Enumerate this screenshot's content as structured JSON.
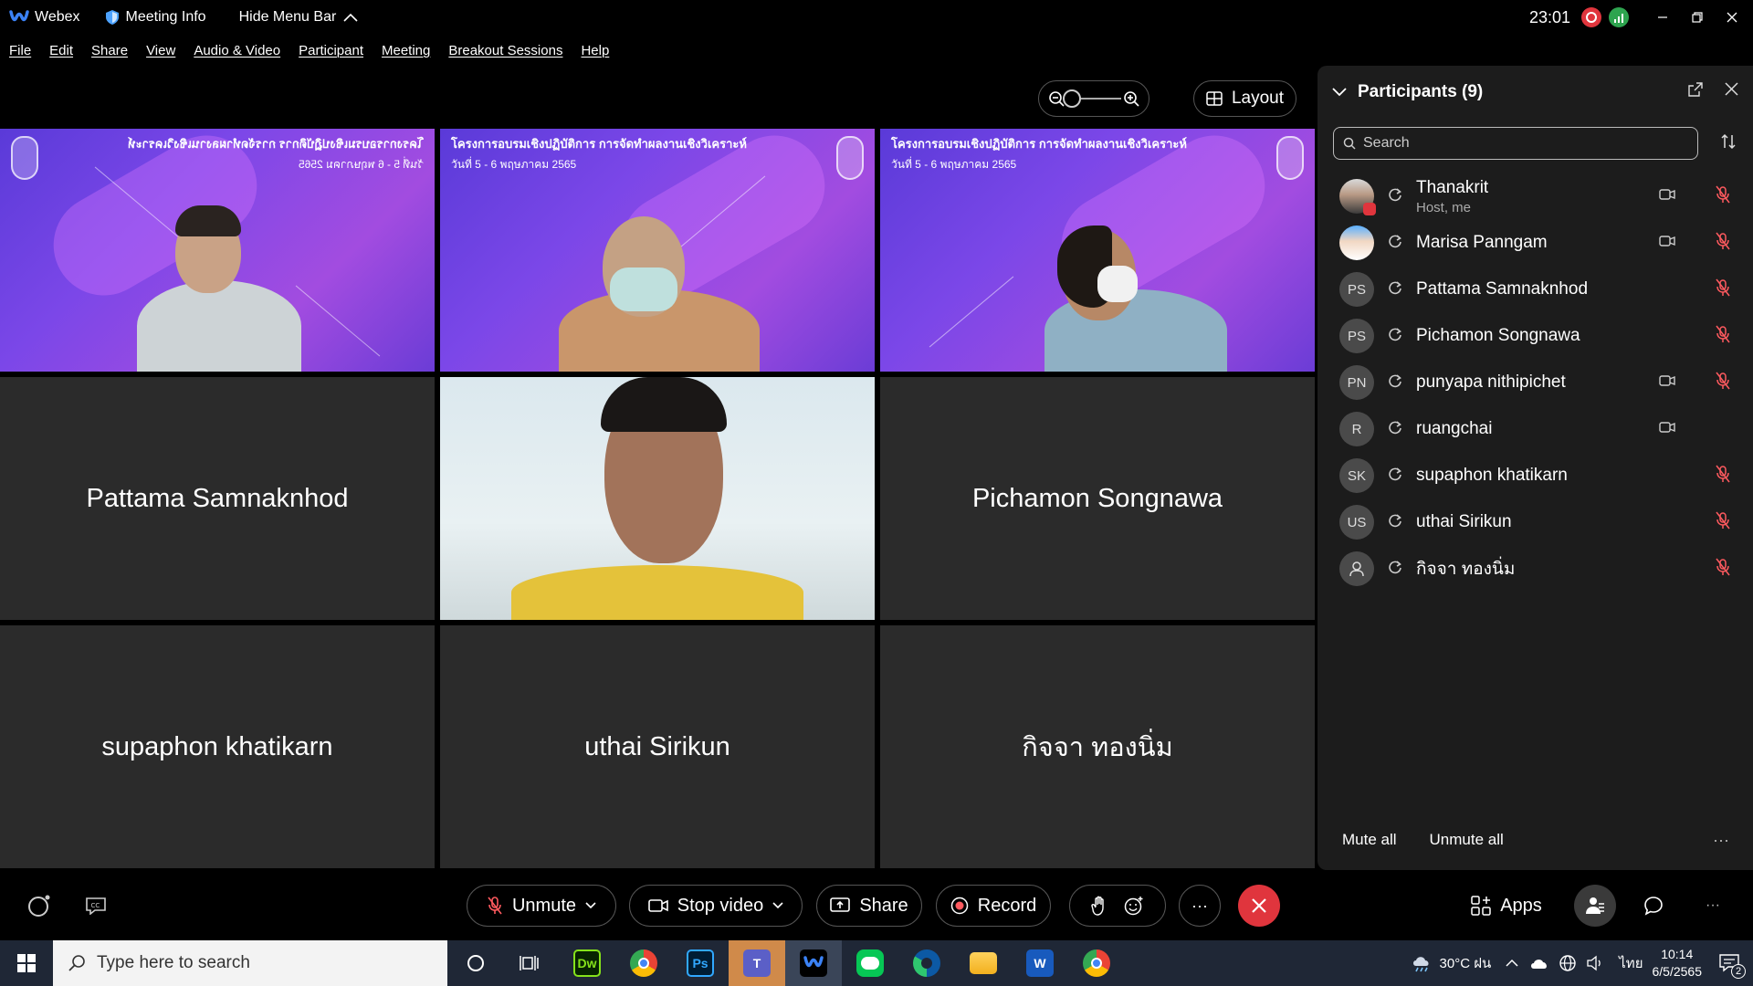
{
  "titlebar": {
    "app_name": "Webex",
    "meeting_info": "Meeting Info",
    "hide_menu": "Hide Menu Bar",
    "clock": "23:01"
  },
  "menu": [
    "File",
    "Edit",
    "Share",
    "View",
    "Audio & Video",
    "Participant",
    "Meeting",
    "Breakout Sessions",
    "Help"
  ],
  "toolbar": {
    "layout_label": "Layout"
  },
  "video_tiles": {
    "banner_title": "โครงการอบรมเชิงปฏิบัติการ การจัดทำผลงานเชิงวิเคราะห์",
    "banner_date": "วันที่ 5 - 6 พฤษภาคม 2565",
    "name_tiles": [
      "Pattama Samnaknhod",
      "Pichamon Songnawa",
      "supaphon khatikarn",
      "uthai Sirikun",
      "กิจจา ทองนิ่ม"
    ]
  },
  "participants_panel": {
    "title": "Participants (9)",
    "search_placeholder": "Search",
    "participants": [
      {
        "name": "Thanakrit",
        "sub": "Host, me",
        "initials": "",
        "camera": true,
        "muted": true
      },
      {
        "name": "Marisa Panngam",
        "sub": "",
        "initials": "",
        "camera": true,
        "muted": true
      },
      {
        "name": "Pattama Samnaknhod",
        "sub": "",
        "initials": "PS",
        "camera": false,
        "muted": true
      },
      {
        "name": "Pichamon Songnawa",
        "sub": "",
        "initials": "PS",
        "camera": false,
        "muted": true
      },
      {
        "name": "punyapa nithipichet",
        "sub": "",
        "initials": "PN",
        "camera": true,
        "muted": true
      },
      {
        "name": "ruangchai",
        "sub": "",
        "initials": "R",
        "camera": true,
        "muted": false
      },
      {
        "name": "supaphon khatikarn",
        "sub": "",
        "initials": "SK",
        "camera": false,
        "muted": true
      },
      {
        "name": "uthai Sirikun",
        "sub": "",
        "initials": "US",
        "camera": false,
        "muted": true
      },
      {
        "name": "กิจจา ทองนิ่ม",
        "sub": "",
        "initials": "",
        "camera": false,
        "muted": true
      }
    ],
    "mute_all": "Mute all",
    "unmute_all": "Unmute all",
    "more": "···"
  },
  "controls": {
    "unmute": "Unmute",
    "stop_video": "Stop video",
    "share": "Share",
    "record": "Record",
    "more": "···",
    "apps": "Apps",
    "overflow": "···"
  },
  "taskbar": {
    "search_placeholder": "Type here to search",
    "weather": "30°C ฝน",
    "lang": "ไทย",
    "time": "10:14",
    "date": "6/5/2565",
    "notifications": "2"
  },
  "colors": {
    "end_red": "#e0353d",
    "panel_bg": "#1c1c1c",
    "tile_bg": "#2b2b2b"
  }
}
